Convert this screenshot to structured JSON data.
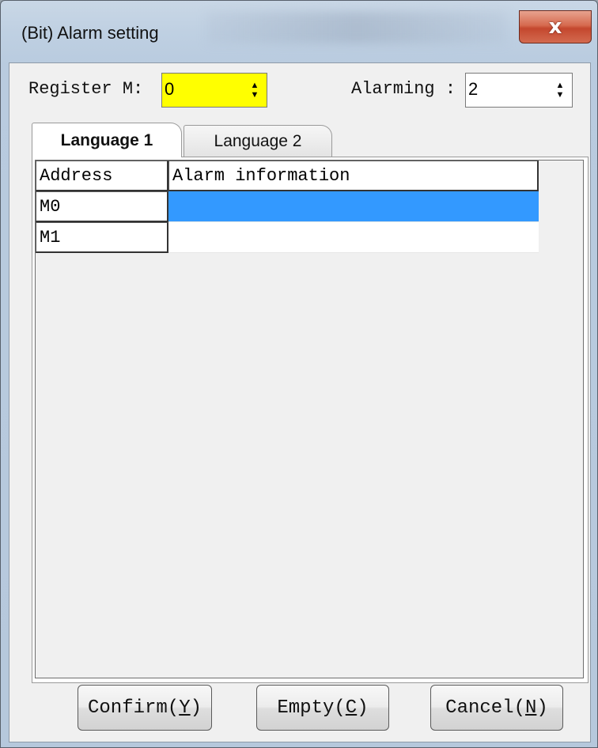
{
  "window": {
    "title": "(Bit) Alarm setting",
    "close_glyph": "x"
  },
  "form": {
    "register_label": "Register M:",
    "register_value": "0",
    "register_highlight": "#ffff00",
    "alarming_label": "Alarming :",
    "alarming_value": "2"
  },
  "tabs": [
    {
      "label": "Language 1",
      "active": true
    },
    {
      "label": "Language 2",
      "active": false
    }
  ],
  "table": {
    "columns": [
      "Address",
      "Alarm information"
    ],
    "rows": [
      {
        "address": "M0",
        "info": "",
        "selected": true
      },
      {
        "address": "M1",
        "info": "",
        "selected": false
      }
    ]
  },
  "buttons": {
    "confirm": {
      "label": "Confirm(",
      "key": "Y",
      "close": ")"
    },
    "empty": {
      "label": "Empty(",
      "key": "C",
      "close": ")"
    },
    "cancel": {
      "label": "Cancel(",
      "key": "N",
      "close": ")"
    }
  },
  "colors": {
    "selection": "#3399ff",
    "close_button": "#c4472e"
  }
}
